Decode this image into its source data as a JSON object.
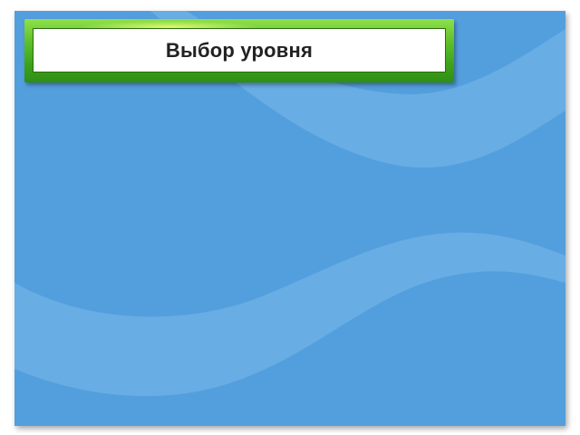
{
  "slide": {
    "title": "Выбор уровня",
    "background_color": "#539fde",
    "wave_color": "#72b2e6",
    "panel_color": "#4db321"
  }
}
